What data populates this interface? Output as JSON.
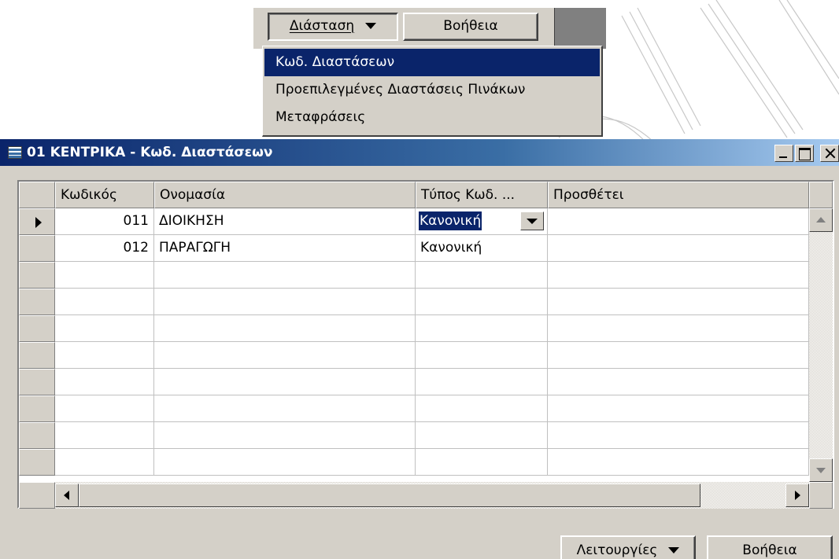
{
  "top_menu": {
    "dimension_button": "Διάσταση",
    "help_button": "Βοήθεια",
    "items": [
      {
        "label": "Κωδ. Διαστάσεων",
        "selected": true
      },
      {
        "label": "Προεπιλεγμένες Διαστάσεις Πινάκων",
        "selected": false
      },
      {
        "label": "Μεταφράσεις",
        "selected": false
      }
    ]
  },
  "window": {
    "title": "01 ΚΕΝΤΡΙΚΑ - Κωδ. Διαστάσεων",
    "columns": [
      "Κωδικός",
      "Ονομασία",
      "Τύπος Κωδ. ...",
      "Προσθέτει"
    ],
    "rows": [
      {
        "code": "011",
        "name": "ΔΙΟΙΚΗΣΗ",
        "type": "Κανονική",
        "adds": "",
        "current": true
      },
      {
        "code": "012",
        "name": "ΠΑΡΑΓΩΓΗ",
        "type": "Κανονική",
        "adds": "",
        "current": false
      }
    ],
    "empty_rows": 8,
    "functions_button": "Λειτουργίες",
    "help_button": "Βοήθεια"
  },
  "colors": {
    "face": "#d4d0c8",
    "selection": "#0a246a",
    "titlebar_start": "#0a246a",
    "titlebar_end": "#a6caf0"
  }
}
